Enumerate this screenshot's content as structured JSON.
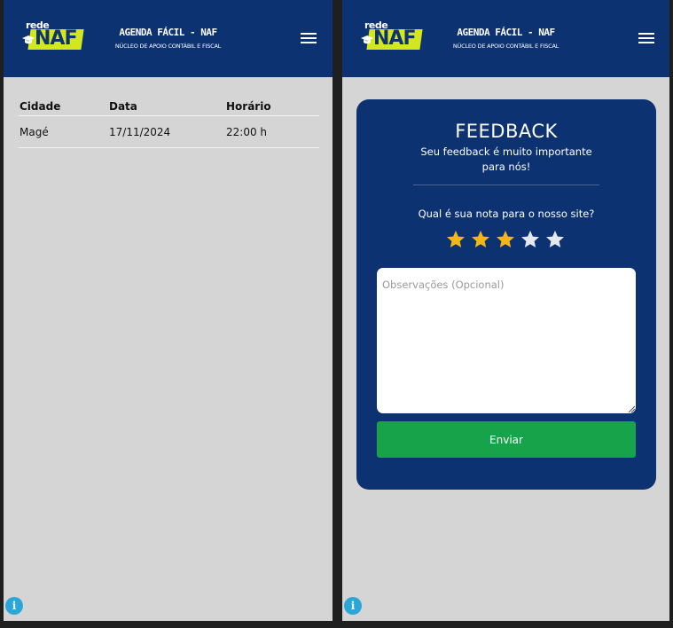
{
  "header": {
    "logo_small": "rede",
    "logo_main": "NAF",
    "title": "AGENDA FÁCIL - NAF",
    "subtitle": "NÚCLEO DE APOIO CONTÁBIL E FISCAL"
  },
  "schedule": {
    "columns": [
      "Cidade",
      "Data",
      "Horário"
    ],
    "rows": [
      {
        "cidade": "Magé",
        "data": "17/11/2024",
        "horario": "22:00 h"
      }
    ]
  },
  "feedback": {
    "title": "FEEDBACK",
    "subtitle": "Seu feedback é muito importante para nós!",
    "question": "Qual é sua nota para o nosso site?",
    "rating": 3,
    "max_rating": 5,
    "textarea_placeholder": "Observações (Opcional)",
    "submit_label": "Enviar"
  },
  "info_icon": "i",
  "colors": {
    "navy": "#0d3272",
    "logo_yellow": "#d3e71e",
    "star_active": "#f6b614",
    "star_inactive": "#e4e8ef",
    "submit_green": "#17a34a",
    "info_blue": "#2aa7d8",
    "page_bg": "#d5d5d5"
  }
}
